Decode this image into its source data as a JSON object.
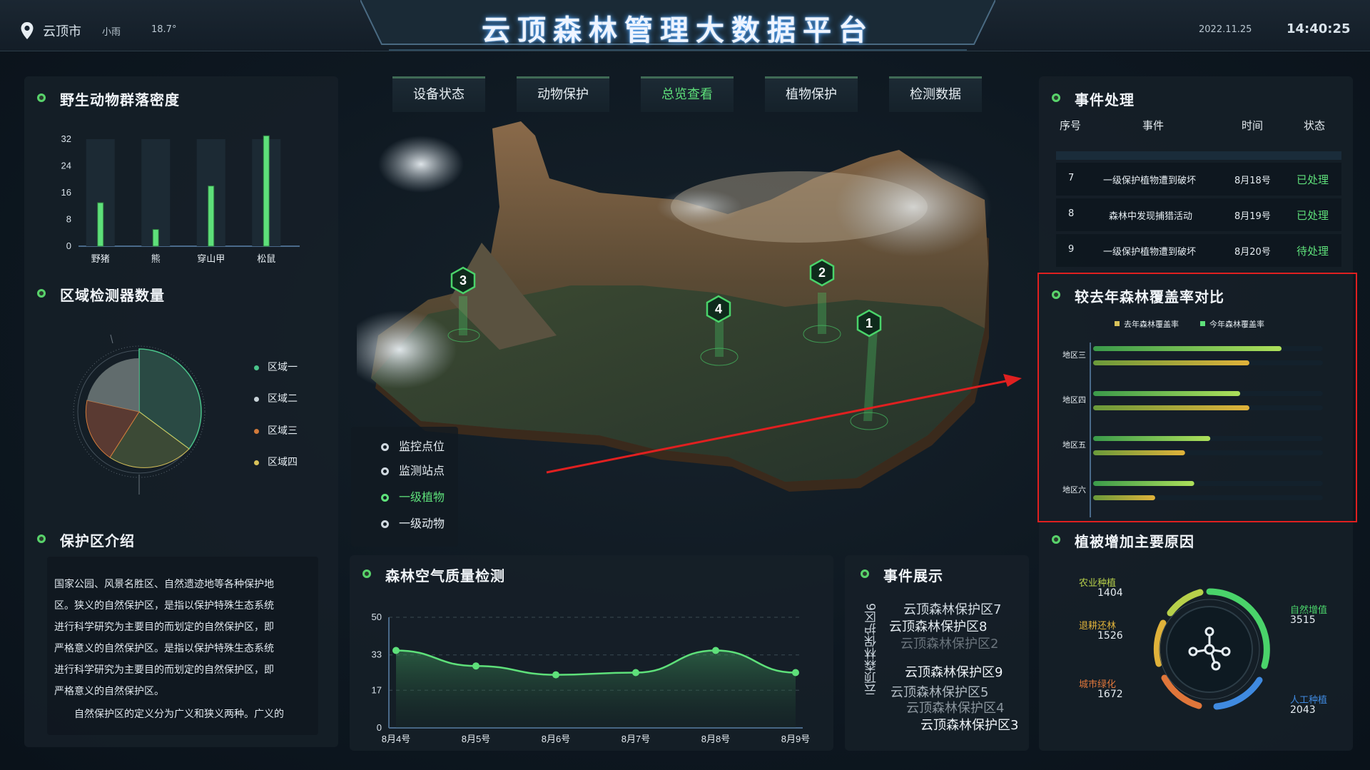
{
  "header": {
    "city": "云顶市",
    "weather": "小雨",
    "temperature": "18.7°",
    "title": "云顶森林管理大数据平台",
    "date": "2022.11.25",
    "time": "14:40:25"
  },
  "nav": {
    "tabs": [
      "设备状态",
      "动物保护",
      "总览查看",
      "植物保护",
      "检测数据"
    ],
    "active_index": 2
  },
  "wildlife": {
    "title": "野生动物群落密度",
    "chart_data": {
      "type": "bar",
      "categories": [
        "野猪",
        "熊",
        "穿山甲",
        "松鼠"
      ],
      "values": [
        13,
        5,
        18,
        33
      ],
      "yticks": [
        "0",
        "8",
        "16",
        "24",
        "32"
      ],
      "ylim": [
        0,
        32
      ]
    }
  },
  "detectors": {
    "title": "区域检测器数量",
    "legend": [
      "区域一",
      "区域二",
      "区域三",
      "区域四"
    ],
    "colors": [
      "#4ac38a",
      "#c8d2d8",
      "#d27a3a",
      "#d8c25a"
    ]
  },
  "reserve": {
    "title": "保护区介绍",
    "lines": [
      "国家公园、风景名胜区、自然遗迹地等各种保护地",
      "区。狭义的自然保护区，是指以保护特殊生态系统",
      "进行科学研究为主要目的而划定的自然保护区，即",
      "严格意义的自然保护区。是指以保护特殊生态系统",
      "进行科学研究为主要目的而划定的自然保护区，即",
      "严格意义的自然保护区。",
      "自然保护区的定义分为广义和狭义两种。广义的"
    ]
  },
  "map": {
    "markers": [
      "1",
      "2",
      "3",
      "4"
    ],
    "legend": [
      "监控点位",
      "监测站点",
      "一级植物",
      "一级动物"
    ],
    "legend_active": 2
  },
  "air": {
    "title": "森林空气质量检测",
    "chart_data": {
      "type": "line",
      "categories": [
        "8月4号",
        "8月5号",
        "8月6号",
        "8月7号",
        "8月8号",
        "8月9号"
      ],
      "values": [
        35,
        28,
        24,
        25,
        35,
        25
      ],
      "yticks": [
        "0",
        "17",
        "33",
        "50"
      ],
      "ylim": [
        0,
        50
      ]
    }
  },
  "events_show": {
    "title": "事件展示",
    "vertical": "云顶森林保护区6",
    "items": [
      "云顶森林保护区7",
      "云顶森林保护区8",
      "云顶森林保护区2",
      "云顶森林保护区9",
      "云顶森林保护区5",
      "云顶森林保护区4",
      "云顶森林保护区3"
    ]
  },
  "events": {
    "title": "事件处理",
    "headers": [
      "序号",
      "事件",
      "时间",
      "状态"
    ],
    "rows": [
      {
        "no": "7",
        "event": "一级保护植物遭到破坏",
        "time": "8月18号",
        "status": "已处理"
      },
      {
        "no": "8",
        "event": "森林中发现捕猎活动",
        "time": "8月19号",
        "status": "已处理"
      },
      {
        "no": "9",
        "event": "一级保护植物遭到破坏",
        "time": "8月20号",
        "status": "待处理"
      }
    ]
  },
  "coverage": {
    "title": "较去年森林覆盖率对比",
    "chart_data": {
      "type": "bar",
      "orientation": "horizontal",
      "categories": [
        "地区三",
        "地区四",
        "地区五",
        "地区六"
      ],
      "series": [
        {
          "name": "今年森林覆盖率",
          "values": [
            82,
            64,
            51,
            44
          ]
        },
        {
          "name": "去年森林覆盖率",
          "values": [
            68,
            68,
            40,
            27
          ]
        }
      ],
      "legend": [
        "去年森林覆盖率",
        "今年森林覆盖率"
      ],
      "xlim": [
        0,
        100
      ]
    }
  },
  "vegetation": {
    "title": "植被增加主要原因",
    "items": [
      {
        "label": "农业种植",
        "value": "1404",
        "color": "#b7d04a"
      },
      {
        "label": "退耕还林",
        "value": "1526",
        "color": "#e0b23a"
      },
      {
        "label": "城市绿化",
        "value": "1672",
        "color": "#e0763a"
      },
      {
        "label": "自然增值",
        "value": "3515",
        "color": "#4ad36a"
      },
      {
        "label": "人工种植",
        "value": "2043",
        "color": "#3f8ae0"
      }
    ]
  }
}
